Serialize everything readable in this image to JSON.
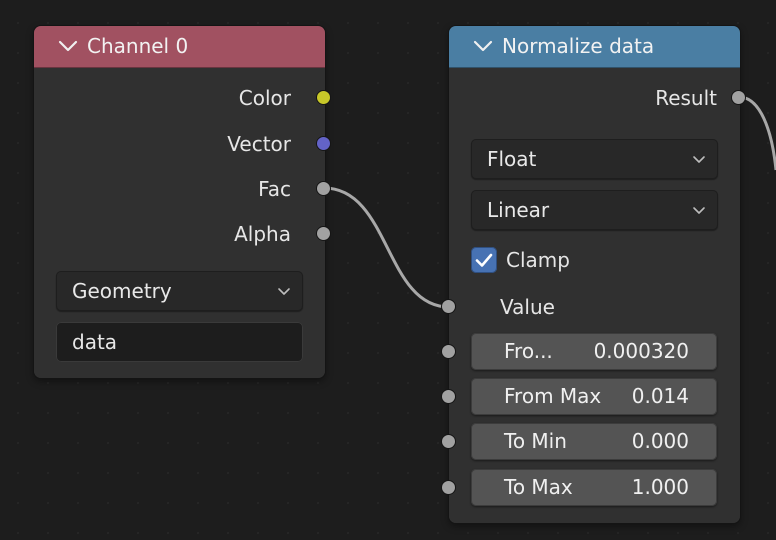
{
  "nodes": {
    "channel": {
      "title": "Channel 0",
      "header_color": "#a15161",
      "outputs": [
        {
          "label": "Color",
          "socket_color": "#c7c729"
        },
        {
          "label": "Vector",
          "socket_color": "#6363c7"
        },
        {
          "label": "Fac",
          "socket_color": "#a1a1a1"
        },
        {
          "label": "Alpha",
          "socket_color": "#a1a1a1"
        }
      ],
      "source_dropdown": "Geometry",
      "attribute_field": "data"
    },
    "normalize": {
      "title": "Normalize data",
      "header_color": "#4a7ea3",
      "output": {
        "label": "Result",
        "socket_color": "#a1a1a1"
      },
      "data_type_dropdown": "Float",
      "interpolation_dropdown": "Linear",
      "clamp": {
        "label": "Clamp",
        "checked": true
      },
      "value_input": {
        "label": "Value",
        "socket_color": "#a1a1a1"
      },
      "fields": [
        {
          "label": "Fro...",
          "value": "0.000320"
        },
        {
          "label": "From Max",
          "value": "0.014"
        },
        {
          "label": "To Min",
          "value": "0.000"
        },
        {
          "label": "To Max",
          "value": "1.000"
        }
      ]
    }
  },
  "colors": {
    "canvas": "#1d1d1d",
    "node_body": "#303030",
    "wire": "#a8a8a8",
    "checkbox": "#4772b3"
  }
}
